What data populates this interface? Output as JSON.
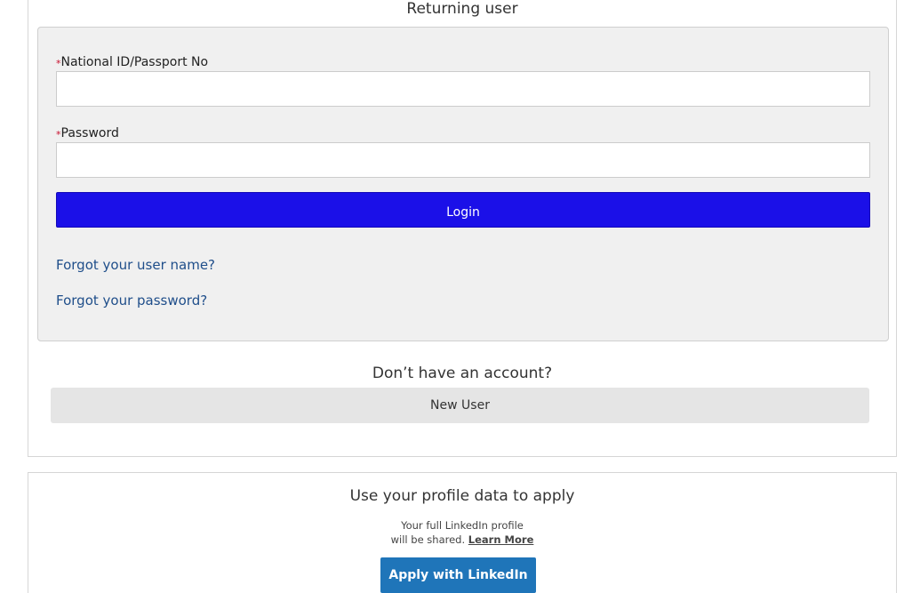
{
  "returning": {
    "title": "Returning user",
    "id_label": "National ID/Passport No",
    "id_value": "",
    "password_label": "Password",
    "password_value": "",
    "required_marker": "*",
    "login_label": "Login",
    "forgot_username": "Forgot your user name?",
    "forgot_password": "Forgot your password?"
  },
  "new_account": {
    "question": "Don’t have an account?",
    "button_label": "New User"
  },
  "linkedin": {
    "title": "Use your profile data to apply",
    "line1": "Your full LinkedIn profile",
    "line2": "will be shared.",
    "learn_more": "Learn More",
    "button_label": "Apply with LinkedIn"
  },
  "colors": {
    "login_button": "#1b10e8",
    "link": "#1f4e8a",
    "linkedin_button": "#1f75b9",
    "required_marker": "#c8102e"
  }
}
